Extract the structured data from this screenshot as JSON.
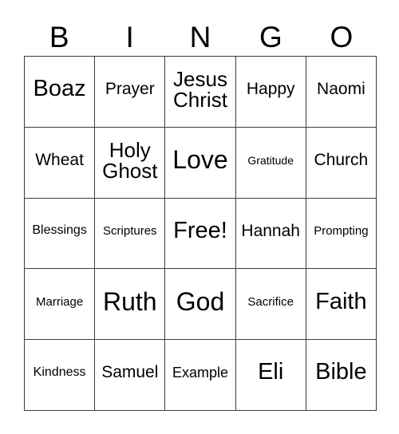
{
  "card": {
    "type": "bingo-card",
    "header_letters": [
      "B",
      "I",
      "N",
      "G",
      "O"
    ],
    "columns": 5,
    "rows": 5,
    "free_space_label": "Free!",
    "free_space_position": "center",
    "text_color": "#000000",
    "background_color": "#ffffff",
    "border_color": "#3c3c3c",
    "squares": [
      [
        {
          "label": "Boaz",
          "size": "xxl"
        },
        {
          "label": "Prayer",
          "size": "ml"
        },
        {
          "label": "Jesus Christ",
          "size": "xl",
          "lines": [
            "Jesus",
            "Christ"
          ]
        },
        {
          "label": "Happy",
          "size": "ml"
        },
        {
          "label": "Naomi",
          "size": "ml"
        }
      ],
      [
        {
          "label": "Wheat",
          "size": "ml"
        },
        {
          "label": "Holy Ghost",
          "size": "xl",
          "lines": [
            "Holy",
            "Ghost"
          ]
        },
        {
          "label": "Love",
          "size": "huge"
        },
        {
          "label": "Gratitude",
          "size": "xs"
        },
        {
          "label": "Church",
          "size": "ml"
        }
      ],
      [
        {
          "label": "Blessings",
          "size": "sm"
        },
        {
          "label": "Scriptures",
          "size": "s"
        },
        {
          "label": "Free!",
          "size": "xxl"
        },
        {
          "label": "Hannah",
          "size": "ml"
        },
        {
          "label": "Prompting",
          "size": "s"
        }
      ],
      [
        {
          "label": "Marriage",
          "size": "s"
        },
        {
          "label": "Ruth",
          "size": "huge"
        },
        {
          "label": "God",
          "size": "huge"
        },
        {
          "label": "Sacrifice",
          "size": "s"
        },
        {
          "label": "Faith",
          "size": "xxl"
        }
      ],
      [
        {
          "label": "Kindness",
          "size": "sm"
        },
        {
          "label": "Samuel",
          "size": "ml"
        },
        {
          "label": "Example",
          "size": "m"
        },
        {
          "label": "Eli",
          "size": "xxl"
        },
        {
          "label": "Bible",
          "size": "xxl"
        }
      ]
    ]
  }
}
